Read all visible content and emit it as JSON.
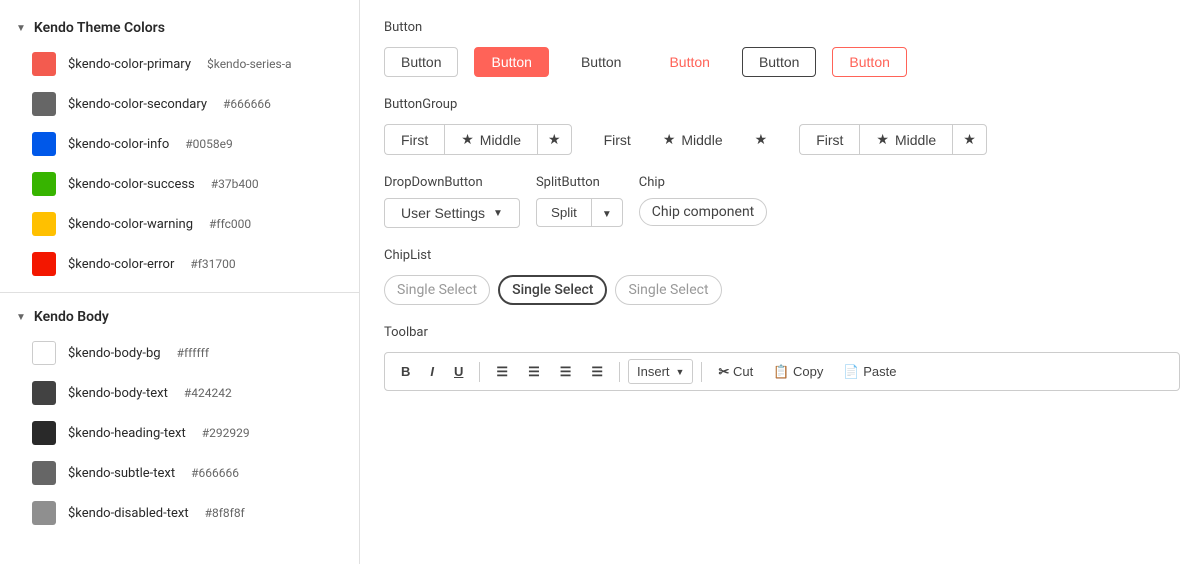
{
  "sidebar": {
    "kendo_theme_header": "Kendo Theme Colors",
    "colors": [
      {
        "name": "$kendo-color-primary",
        "alias": "$kendo-series-a",
        "hex": "#f35b4f",
        "swatch": "#f35b4f"
      },
      {
        "name": "$kendo-color-secondary",
        "alias": "#666666",
        "hex": "#666666",
        "swatch": "#666666"
      },
      {
        "name": "$kendo-color-info",
        "alias": "#0058e9",
        "hex": "#0058e9",
        "swatch": "#0058e9"
      },
      {
        "name": "$kendo-color-success",
        "alias": "#37b400",
        "hex": "#37b400",
        "swatch": "#37b400"
      },
      {
        "name": "$kendo-color-warning",
        "alias": "#ffc000",
        "hex": "#ffc000",
        "swatch": "#ffc000"
      },
      {
        "name": "$kendo-color-error",
        "alias": "#f31700",
        "hex": "#f31700",
        "swatch": "#f31700"
      }
    ],
    "kendo_body_header": "Kendo Body",
    "body_colors": [
      {
        "name": "$kendo-body-bg",
        "alias": "#ffffff",
        "hex": "#ffffff",
        "swatch": "#ffffff",
        "border": true
      },
      {
        "name": "$kendo-body-text",
        "alias": "#424242",
        "hex": "#424242",
        "swatch": "#424242"
      },
      {
        "name": "$kendo-heading-text",
        "alias": "#292929",
        "hex": "#292929",
        "swatch": "#292929"
      },
      {
        "name": "$kendo-subtle-text",
        "alias": "#666666",
        "hex": "#666666",
        "swatch": "#666666"
      },
      {
        "name": "$kendo-disabled-text",
        "alias": "#8f8f8f",
        "hex": "#8f8f8f",
        "swatch": "#8f8f8f"
      }
    ]
  },
  "main": {
    "button_section": "Button",
    "buttons": [
      {
        "label": "Button",
        "style": "default"
      },
      {
        "label": "Button",
        "style": "primary"
      },
      {
        "label": "Button",
        "style": "flat"
      },
      {
        "label": "Button",
        "style": "link"
      },
      {
        "label": "Button",
        "style": "outline"
      },
      {
        "label": "Button",
        "style": "outline-primary"
      }
    ],
    "button_group_section": "ButtonGroup",
    "button_groups": [
      {
        "style": "default",
        "items": [
          {
            "label": "First",
            "icon": false
          },
          {
            "label": "Middle",
            "icon": true
          },
          {
            "label": "",
            "icon": true,
            "icon_only": true
          }
        ]
      },
      {
        "style": "default",
        "items": [
          {
            "label": "First",
            "icon": false
          },
          {
            "label": "Middle",
            "icon": true
          },
          {
            "label": "",
            "icon": true,
            "icon_only": true
          }
        ]
      },
      {
        "style": "outline",
        "items": [
          {
            "label": "First",
            "icon": false
          },
          {
            "label": "Middle",
            "icon": true
          },
          {
            "label": "",
            "icon": true,
            "icon_only": true
          }
        ]
      }
    ],
    "dropdown_section": "DropDownButton",
    "dropdown_label": "User Settings",
    "split_section": "SplitButton",
    "split_label": "Split",
    "chip_section": "Chip",
    "chip_label": "Chip component",
    "chiplist_section": "ChipList",
    "chiplist_items": [
      {
        "label": "Single Select",
        "selected": false
      },
      {
        "label": "Single Select",
        "selected": true
      },
      {
        "label": "Single Select",
        "selected": false
      }
    ],
    "toolbar_section": "Toolbar",
    "toolbar_buttons": [
      {
        "label": "B",
        "type": "bold"
      },
      {
        "label": "I",
        "type": "italic"
      },
      {
        "label": "U",
        "type": "underline"
      }
    ],
    "toolbar_align": [
      {
        "label": "≡",
        "type": "align-left"
      },
      {
        "label": "≡",
        "type": "align-center"
      },
      {
        "label": "≡",
        "type": "align-right"
      },
      {
        "label": "≡",
        "type": "align-justify"
      }
    ],
    "toolbar_insert": "Insert",
    "toolbar_cut": "Cut",
    "toolbar_copy": "Copy",
    "toolbar_paste": "Paste"
  }
}
